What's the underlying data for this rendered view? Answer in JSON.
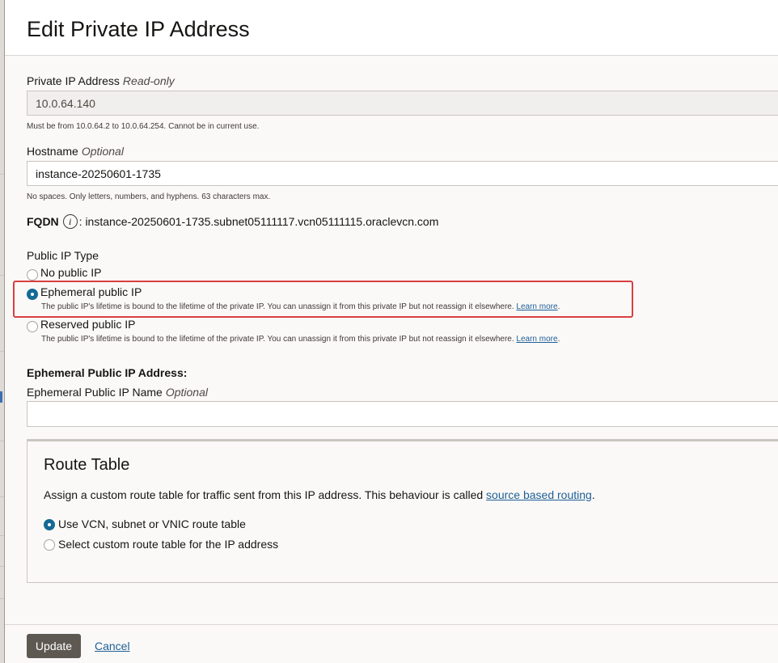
{
  "dialog": {
    "title": "Edit Private IP Address"
  },
  "private_ip": {
    "label": "Private IP Address",
    "tag": "Read-only",
    "value": "10.0.64.140",
    "help": "Must be from 10.0.64.2 to 10.0.64.254. Cannot be in current use."
  },
  "hostname": {
    "label": "Hostname",
    "tag": "Optional",
    "value": "instance-20250601-1735",
    "help": "No spaces. Only letters, numbers, and hyphens. 63 characters max."
  },
  "fqdn": {
    "label": "FQDN",
    "icon": "info-icon",
    "value": ": instance-20250601-1735.subnet05111117.vcn05111115.oraclevcn.com"
  },
  "public_ip_type": {
    "label": "Public IP Type",
    "selected": "ephemeral",
    "options": [
      {
        "label": "No public IP"
      },
      {
        "label": "Ephemeral public IP",
        "desc": "The public IP's lifetime is bound to the lifetime of the private IP. You can unassign it from this private IP but not reassign it elsewhere.",
        "link": "Learn more"
      },
      {
        "label": "Reserved public IP",
        "desc": "The public IP's lifetime is bound to the lifetime of the private IP. You can unassign it from this private IP but not reassign it elsewhere.",
        "link": "Learn more"
      }
    ]
  },
  "ephemeral": {
    "heading": "Ephemeral Public IP Address:",
    "name_label": "Ephemeral Public IP Name",
    "name_tag": "Optional",
    "name_value": ""
  },
  "route_table": {
    "title": "Route Table",
    "desc": "Assign a custom route table for traffic sent from this IP address. This behaviour is called ",
    "desc_link": "source based routing",
    "desc_end": ".",
    "options": [
      {
        "label": "Use VCN, subnet or VNIC route table"
      },
      {
        "label": "Select custom route table for the IP address"
      }
    ],
    "selected": "vcn"
  },
  "footer": {
    "update": "Update",
    "cancel": "Cancel"
  },
  "colors": {
    "accent": "#156a94",
    "highlight": "#d93f3f",
    "button": "#5e5853",
    "link": "#1d5f95"
  }
}
